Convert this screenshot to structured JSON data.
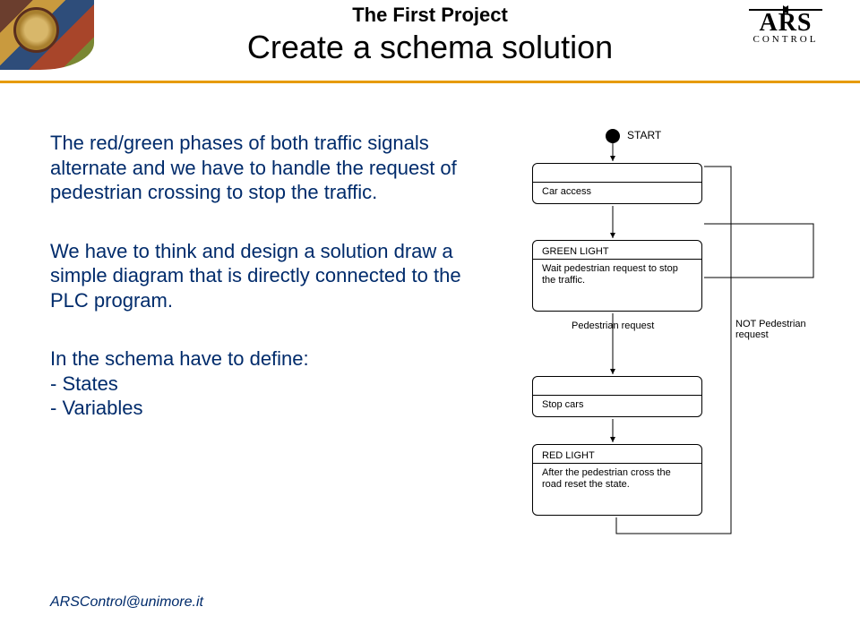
{
  "header": {
    "sup_title": "The First Project",
    "main_title": "Create a schema solution",
    "ars_big": "ARS",
    "ars_small": "CONTROL"
  },
  "body": {
    "para1": "The red/green phases of both traffic signals alternate and we have to handle the request of pedestrian crossing to stop the traffic.",
    "para2": "We have to think and design a solution draw a simple diagram that is directly connected to the PLC program.",
    "para3_intro": "In the schema have to define:",
    "para3_item1": "- States",
    "para3_item2": "- Variables"
  },
  "flow": {
    "start": "START",
    "box1_heading": "",
    "box1_desc": "Car access",
    "box2_heading": "GREEN LIGHT",
    "box2_desc": "Wait pedestrian request to stop the traffic.",
    "branch_ped": "Pedestrian request",
    "branch_not": "NOT Pedestrian request",
    "box3_desc": "Stop cars",
    "box4_heading": "RED LIGHT",
    "box4_desc": "After the pedestrian cross the road reset the state."
  },
  "footer": "ARSControl@unimore.it"
}
